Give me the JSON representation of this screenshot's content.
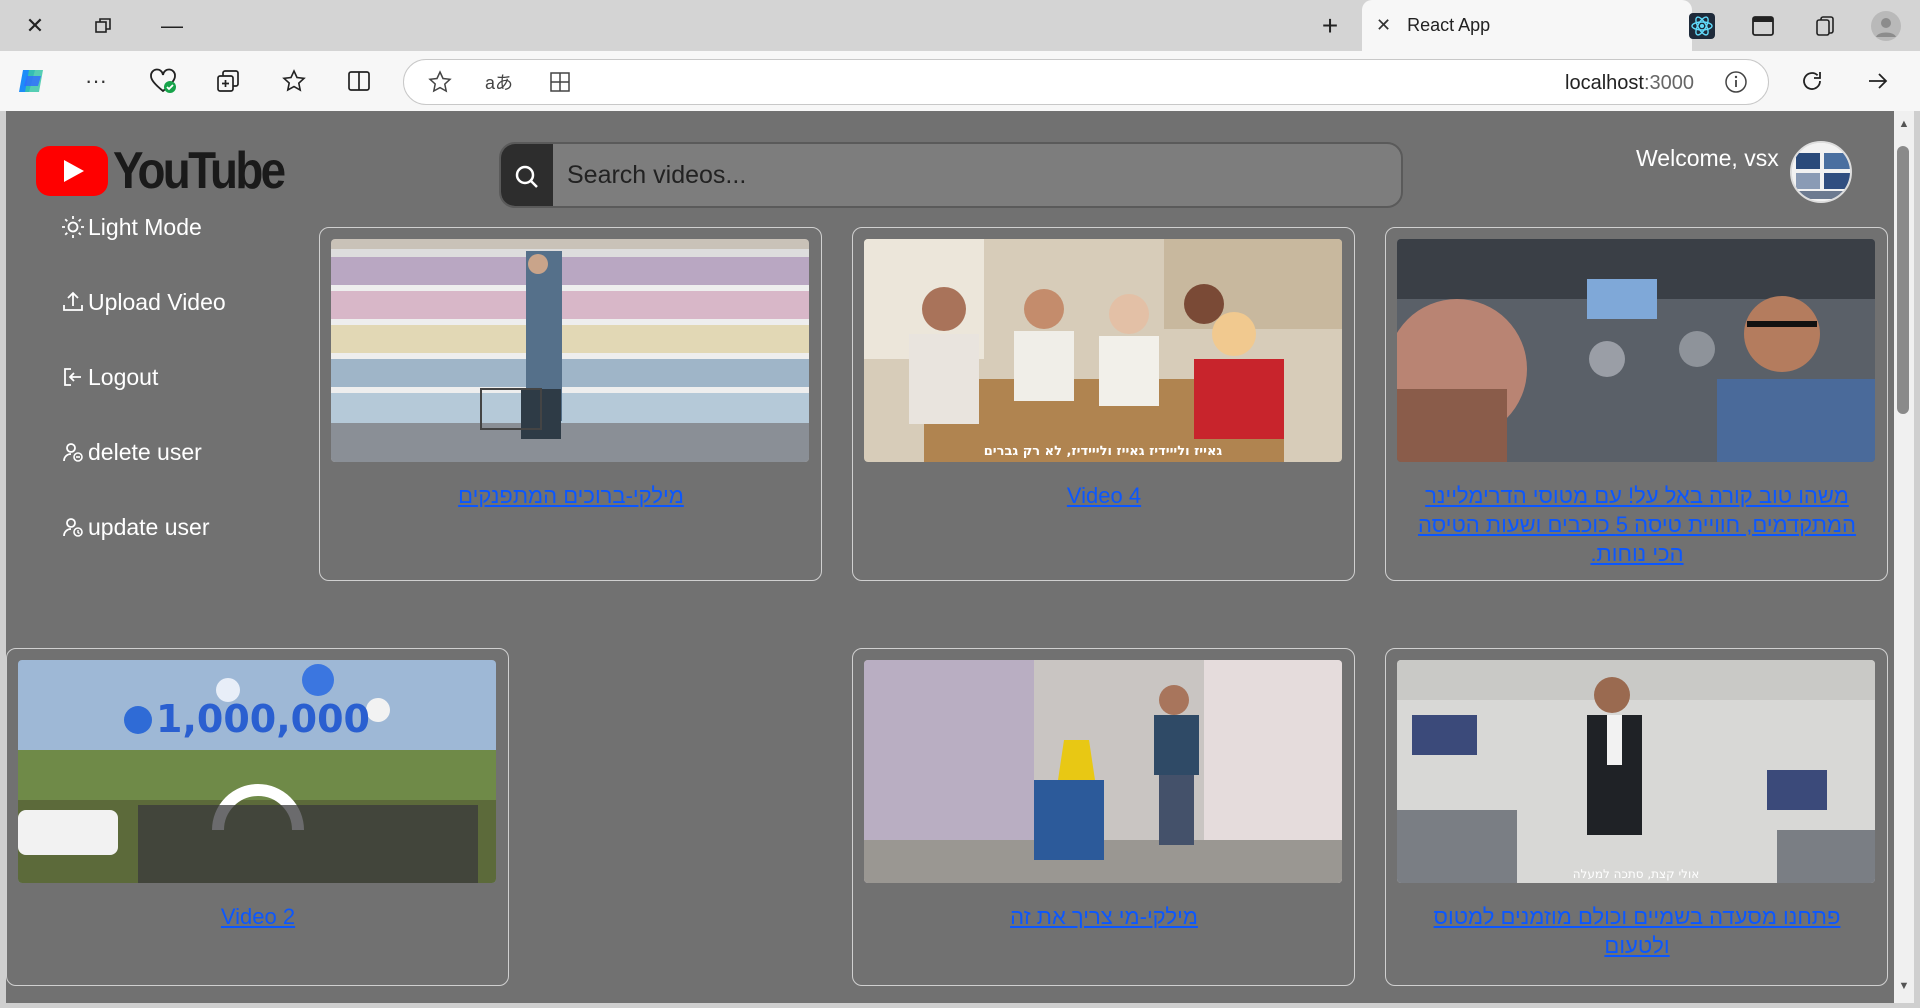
{
  "browser": {
    "tab_title": "React App",
    "url_host": "localhost",
    "url_port": ":3000"
  },
  "app": {
    "logo_text": "YouTube",
    "search_placeholder": "Search videos...",
    "welcome_text": "Welcome, vsx",
    "sidebar": [
      {
        "label": "Light Mode",
        "icon": "sun-icon"
      },
      {
        "label": "Upload Video",
        "icon": "upload-icon"
      },
      {
        "label": "Logout",
        "icon": "logout-icon"
      },
      {
        "label": "delete user",
        "icon": "user-delete-icon"
      },
      {
        "label": "update user",
        "icon": "user-update-icon"
      }
    ],
    "videos": [
      {
        "title": "מילקי-ברוכים המתפנקים",
        "thumb": "supermarket-aisle"
      },
      {
        "title": "Video 4",
        "thumb": "kitchen-table",
        "caption": "גאייז ולייידיז גאייז ולייידיז, לא רק גברים"
      },
      {
        "title": "משהו טוב קורה באל על! עם מטוסי הדרימליינר המתקדמים, חוויית טיסה 5 כוכבים ושעות הטיסה הכי נוחות.",
        "thumb": "airport-man"
      },
      {
        "title": "Video 2",
        "thumb": "balloons-celebration",
        "balloon_text": "1,000,000"
      },
      {
        "title": "מילקי-מי צריך את זה",
        "thumb": "supermarket-cleaner"
      },
      {
        "title": "פתחנו מסעדה בשמיים וכולם מוזמנים למטוס ולטעום",
        "thumb": "airplane-steward",
        "caption": "אולי קצת, סתכה למעלה"
      }
    ]
  },
  "colors": {
    "app_bg": "#717171",
    "link": "#0b57ff",
    "logo_red": "#ff0000"
  }
}
